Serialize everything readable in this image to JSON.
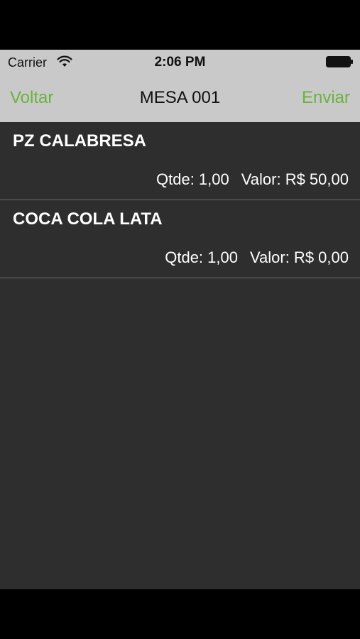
{
  "status_bar": {
    "carrier": "Carrier",
    "time": "2:06 PM",
    "icons": [
      "wifi-icon",
      "battery-icon"
    ]
  },
  "nav_bar": {
    "back_label": "Voltar",
    "title": "MESA 001",
    "send_label": "Enviar",
    "accent_color": "#6ab23e"
  },
  "items": [
    {
      "name": "PZ CALABRESA",
      "quantity": "Qtde: 1,00",
      "value": "Valor: R$ 50,00"
    },
    {
      "name": "COCA COLA LATA",
      "quantity": "Qtde: 1,00",
      "value": "Valor: R$ 0,00"
    }
  ]
}
